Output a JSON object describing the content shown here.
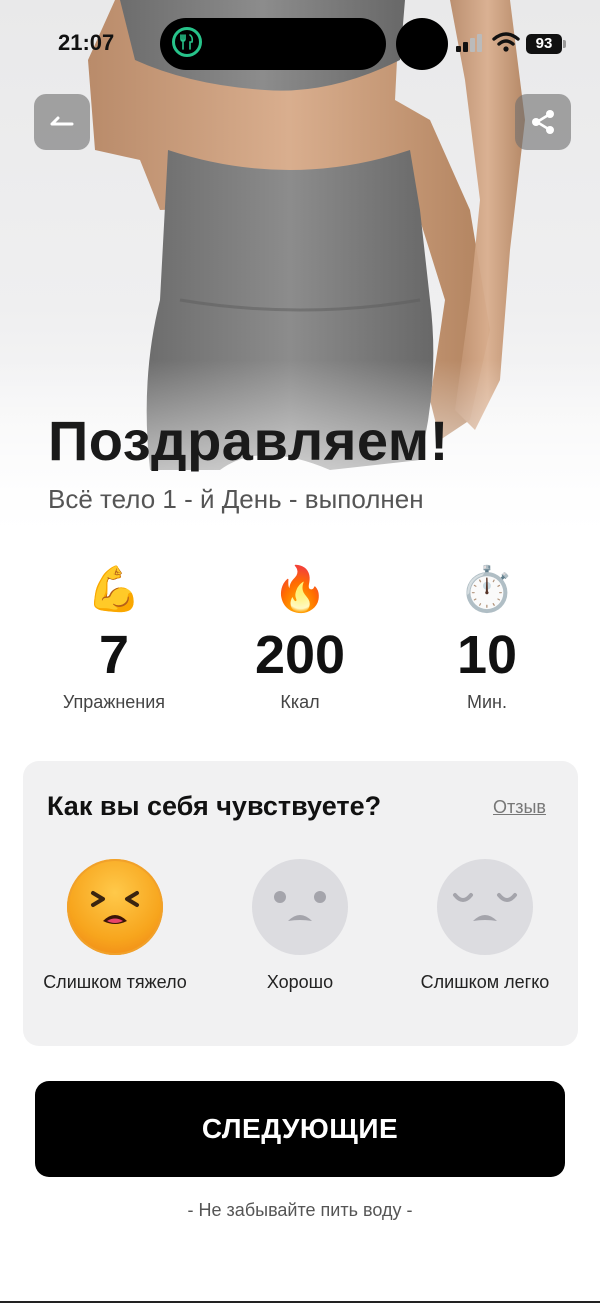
{
  "status_bar": {
    "time": "21:07",
    "battery": "93",
    "app_indicator_icon": "fork-knife-icon"
  },
  "header": {
    "back_icon": "back-arrow-icon",
    "share_icon": "share-icon"
  },
  "hero": {
    "title": "Поздравляем!",
    "subtitle": "Всё тело 1 - й День - выполнен"
  },
  "stats": [
    {
      "icon": "flexed-biceps-icon",
      "emoji": "💪",
      "value": "7",
      "label": "Упражнения"
    },
    {
      "icon": "fire-icon",
      "emoji": "🔥",
      "value": "200",
      "label": "Ккал"
    },
    {
      "icon": "stopwatch-icon",
      "emoji": "⏱️",
      "value": "10",
      "label": "Мин."
    }
  ],
  "feedback": {
    "question": "Как вы себя чувствуете?",
    "review_link": "Отзыв",
    "options": [
      {
        "label": "Слишком тяжело",
        "icon": "struggling-face-icon",
        "selected": true
      },
      {
        "label": "Хорошо",
        "icon": "neutral-face-icon",
        "selected": false
      },
      {
        "label": "Слишком легко",
        "icon": "relieved-face-icon",
        "selected": false
      }
    ]
  },
  "next_button": "СЛЕДУЮЩИЕ",
  "water_note": "- Не забывайте пить воду -",
  "colors": {
    "accent_ring": "#27c38a",
    "button_bg": "#000000",
    "card_bg": "#f1f1f2",
    "selected_face": "#f7a51d",
    "unselected_face": "#dcdce0"
  }
}
